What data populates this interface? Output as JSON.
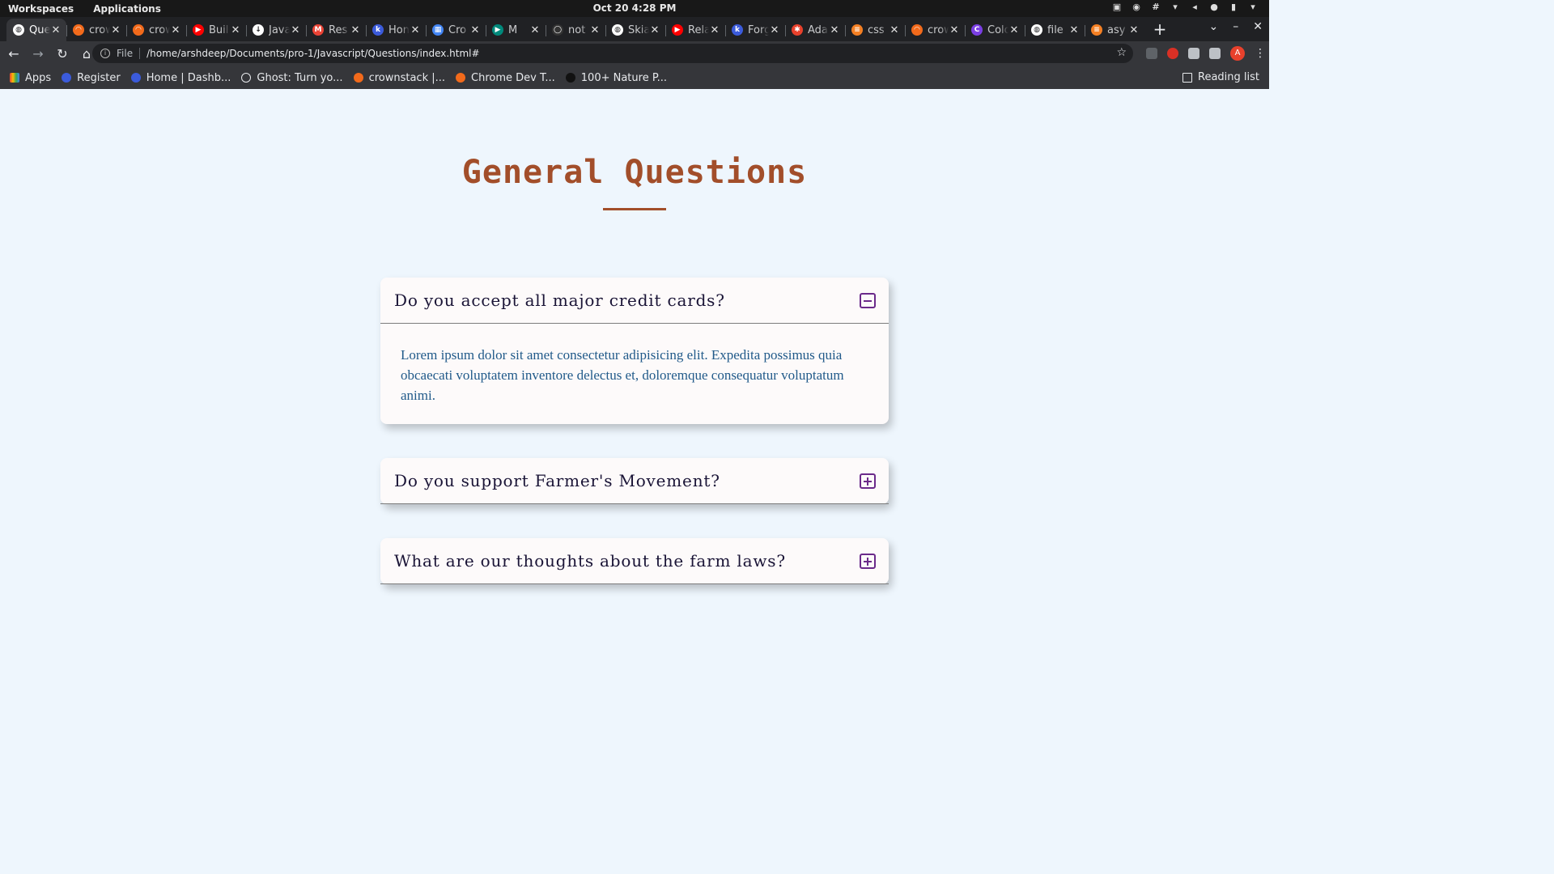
{
  "system_bar": {
    "workspaces": "Workspaces",
    "applications": "Applications",
    "datetime": "Oct 20  4:28 PM"
  },
  "browser": {
    "tabs": [
      {
        "title": "Que",
        "icon": "globe-icon",
        "color": "#ffffff",
        "active": true
      },
      {
        "title": "crow",
        "icon": "crownstack-icon",
        "color": "#f26a1b"
      },
      {
        "title": "crow",
        "icon": "crownstack-icon",
        "color": "#f26a1b"
      },
      {
        "title": "Buil",
        "icon": "youtube-icon",
        "color": "#ff0000"
      },
      {
        "title": "Java",
        "icon": "download-icon",
        "color": "#ffffff"
      },
      {
        "title": "Res",
        "icon": "gmail-icon",
        "color": "#ea4335"
      },
      {
        "title": "Hon",
        "icon": "k-icon",
        "color": "#3b5bdb"
      },
      {
        "title": "Cro",
        "icon": "calendar-icon",
        "color": "#4285f4"
      },
      {
        "title": "M",
        "icon": "meet-icon",
        "color": "#00897b"
      },
      {
        "title": "not",
        "icon": "github-icon",
        "color": "#333333"
      },
      {
        "title": "Skia",
        "icon": "globe-icon",
        "color": "#ffffff"
      },
      {
        "title": "Rela",
        "icon": "youtube-icon",
        "color": "#ff0000"
      },
      {
        "title": "Forg",
        "icon": "k-icon",
        "color": "#3b5bdb"
      },
      {
        "title": "Ada",
        "icon": "asterisk-icon",
        "color": "#e8412c"
      },
      {
        "title": "css",
        "icon": "stackoverflow-icon",
        "color": "#f48024"
      },
      {
        "title": "crow",
        "icon": "crownstack-icon",
        "color": "#f26a1b"
      },
      {
        "title": "Colo",
        "icon": "c-icon",
        "color": "#7b3fe4"
      },
      {
        "title": "file",
        "icon": "globe-icon",
        "color": "#ffffff"
      },
      {
        "title": "asy",
        "icon": "stackoverflow-icon",
        "color": "#f48024"
      }
    ],
    "omnibox": {
      "scheme": "File",
      "url": "/home/arshdeep/Documents/pro-1/Javascript/Questions/index.html#"
    },
    "avatar_letter": "A",
    "bookmarks": [
      {
        "label": "Apps",
        "icon": "apps-grid-icon",
        "color": "#4285f4"
      },
      {
        "label": "Register",
        "icon": "k-icon",
        "color": "#3b5bdb"
      },
      {
        "label": "Home | Dashb...",
        "icon": "k-icon",
        "color": "#3b5bdb"
      },
      {
        "label": "Ghost: Turn yo...",
        "icon": "ghost-icon",
        "color": "#202124"
      },
      {
        "label": "crownstack |...",
        "icon": "crownstack-icon",
        "color": "#f26a1b"
      },
      {
        "label": "Chrome Dev T...",
        "icon": "crownstack-icon",
        "color": "#f26a1b"
      },
      {
        "label": "100+ Nature P...",
        "icon": "unsplash-icon",
        "color": "#111111"
      }
    ],
    "reading_list": "Reading list"
  },
  "page": {
    "title": "General Questions",
    "accent_color": "#a24e2a",
    "questions": [
      {
        "question": "Do you accept all major credit cards?",
        "expanded": true,
        "answer": "Lorem ipsum dolor sit amet consectetur adipisicing elit. Expedita possimus quia obcaecati voluptatem inventore delectus et, doloremque consequatur voluptatum animi."
      },
      {
        "question": "Do you support Farmer's Movement?",
        "expanded": false,
        "answer": ""
      },
      {
        "question": "What are our thoughts about the farm laws?",
        "expanded": false,
        "answer": ""
      }
    ]
  }
}
